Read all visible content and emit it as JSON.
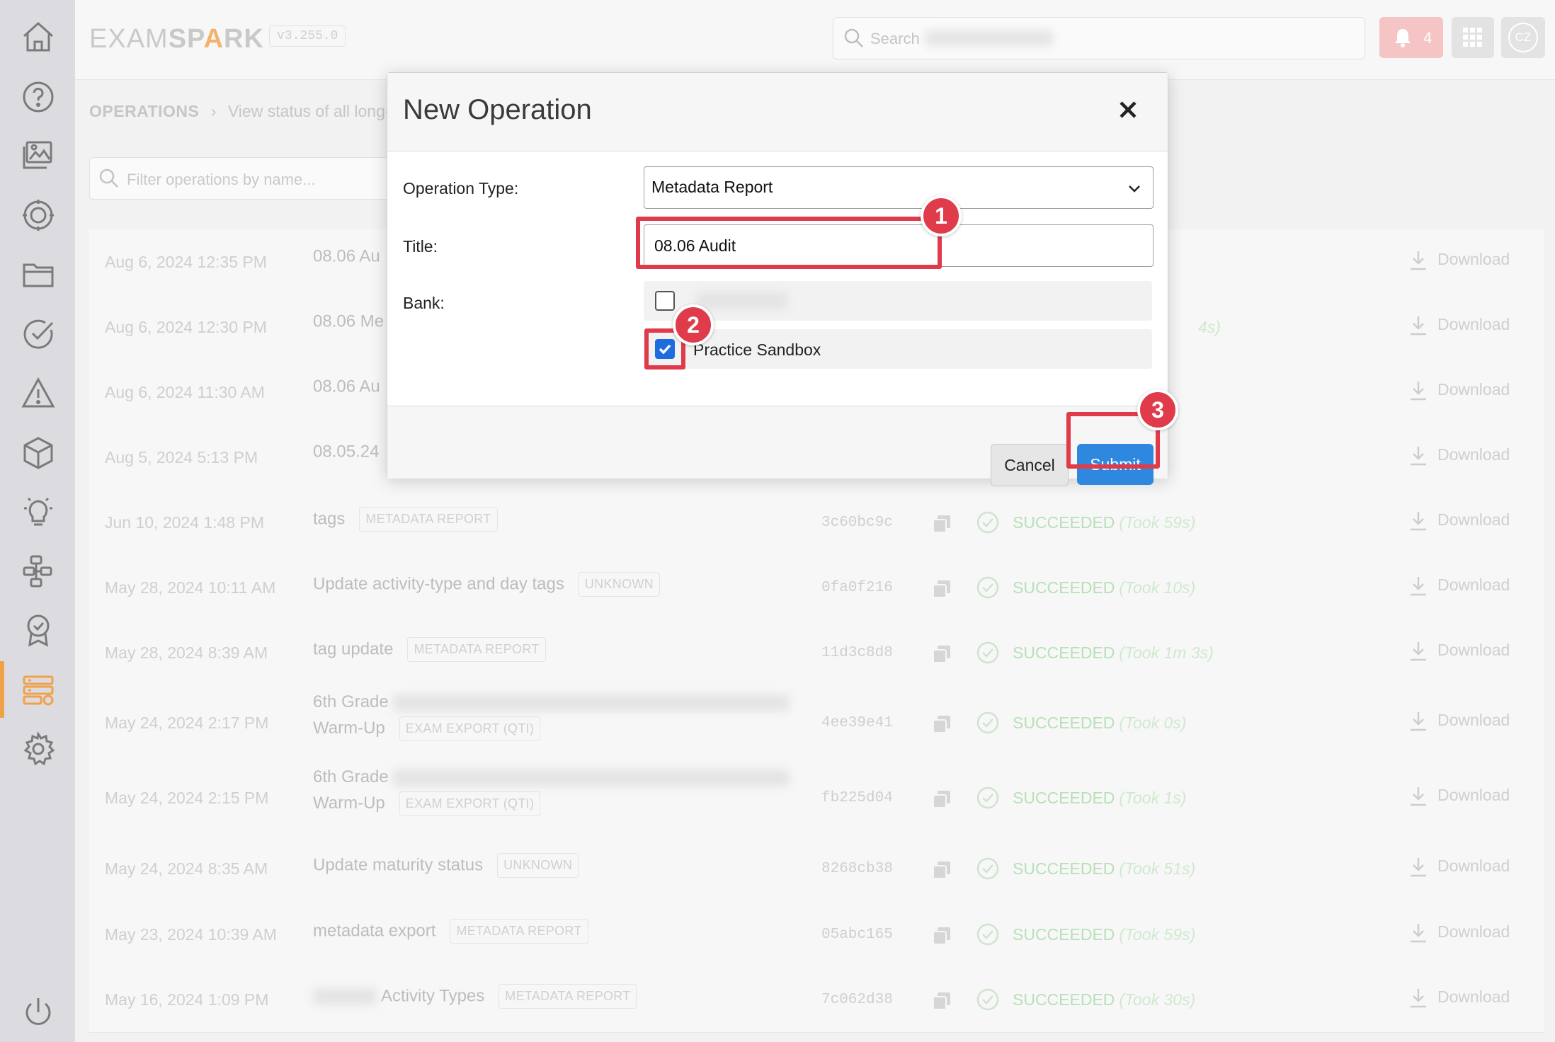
{
  "app": {
    "logo_left": "EXAM",
    "logo_mid": "SP",
    "logo_flame": "A",
    "logo_right": "RK",
    "version": "v3.255.0"
  },
  "topbar": {
    "search_placeholder": "Search",
    "notification_count": "4",
    "avatar_initials": "CZ"
  },
  "breadcrumb": {
    "root": "OPERATIONS",
    "current": "View status of all long-"
  },
  "filter": {
    "placeholder": "Filter operations by name..."
  },
  "sidebar": {
    "icons": [
      "home-icon",
      "help-icon",
      "images-icon",
      "target-icon",
      "folder-icon",
      "check-circle-icon",
      "warning-icon",
      "cube-icon",
      "lightbulb-icon",
      "workflow-icon",
      "award-icon",
      "operations-icon",
      "settings-icon",
      "power-icon"
    ]
  },
  "operations": [
    {
      "date": "Aug 6, 2024 12:35 PM",
      "name": "08.06 Au",
      "tag": "",
      "hash": "",
      "status": "",
      "took": "",
      "download": "Download"
    },
    {
      "date": "Aug 6, 2024 12:30 PM",
      "name": "08.06 Me",
      "tag": "",
      "hash": "",
      "status": "",
      "took": "4s)",
      "download": "Download"
    },
    {
      "date": "Aug 6, 2024 11:30 AM",
      "name": "08.06 Au",
      "tag": "",
      "hash": "",
      "status": "",
      "took": "",
      "download": "Download"
    },
    {
      "date": "Aug 5, 2024 5:13 PM",
      "name": "08.05.24",
      "tag": "",
      "hash": "",
      "status": "",
      "took": "",
      "download": "Download"
    },
    {
      "date": "Jun 10, 2024 1:48 PM",
      "name": "tags",
      "tag": "METADATA REPORT",
      "hash": "3c60bc9c",
      "status": "SUCCEEDED",
      "took": "(Took 59s)",
      "download": "Download"
    },
    {
      "date": "May 28, 2024 10:11 AM",
      "name": "Update activity-type and day tags",
      "tag": "UNKNOWN",
      "hash": "0fa0f216",
      "status": "SUCCEEDED",
      "took": "(Took 10s)",
      "download": "Download"
    },
    {
      "date": "May 28, 2024 8:39 AM",
      "name": "tag update",
      "tag": "METADATA REPORT",
      "hash": "11d3c8d8",
      "status": "SUCCEEDED",
      "took": "(Took 1m 3s)",
      "download": "Download"
    },
    {
      "date": "May 24, 2024 2:17 PM",
      "name": "6th Grade",
      "name2": "Warm-Up",
      "tag": "EXAM EXPORT (QTI)",
      "hash": "4ee39e41",
      "status": "SUCCEEDED",
      "took": "(Took 0s)",
      "download": "Download"
    },
    {
      "date": "May 24, 2024 2:15 PM",
      "name": "6th Grade",
      "name2": "Warm-Up",
      "tag": "EXAM EXPORT (QTI)",
      "hash": "fb225d04",
      "status": "SUCCEEDED",
      "took": "(Took 1s)",
      "download": "Download"
    },
    {
      "date": "May 24, 2024 8:35 AM",
      "name": "Update maturity status",
      "tag": "UNKNOWN",
      "hash": "8268cb38",
      "status": "SUCCEEDED",
      "took": "(Took 51s)",
      "download": "Download"
    },
    {
      "date": "May 23, 2024 10:39 AM",
      "name": "metadata export",
      "tag": "METADATA REPORT",
      "hash": "05abc165",
      "status": "SUCCEEDED",
      "took": "(Took 59s)",
      "download": "Download"
    },
    {
      "date": "May 16, 2024 1:09 PM",
      "name": "Activity Types",
      "tag": "METADATA REPORT",
      "hash": "7c062d38",
      "status": "SUCCEEDED",
      "took": "(Took 30s)",
      "download": "Download"
    }
  ],
  "modal": {
    "title": "New Operation",
    "operation_type_label": "Operation Type:",
    "operation_type_value": "Metadata Report",
    "title_label": "Title:",
    "title_value": "08.06 Audit",
    "bank_label": "Bank:",
    "bank_options": [
      {
        "name": "",
        "checked": false
      },
      {
        "name": "Practice Sandbox",
        "checked": true
      }
    ],
    "cancel_label": "Cancel",
    "submit_label": "Submit"
  },
  "annotations": [
    "1",
    "2",
    "3"
  ],
  "colors": {
    "accent": "#2f88e0",
    "highlight": "#e03b4a",
    "success": "#b8e0b8",
    "sidebar_bg": "#dcdbe0"
  }
}
